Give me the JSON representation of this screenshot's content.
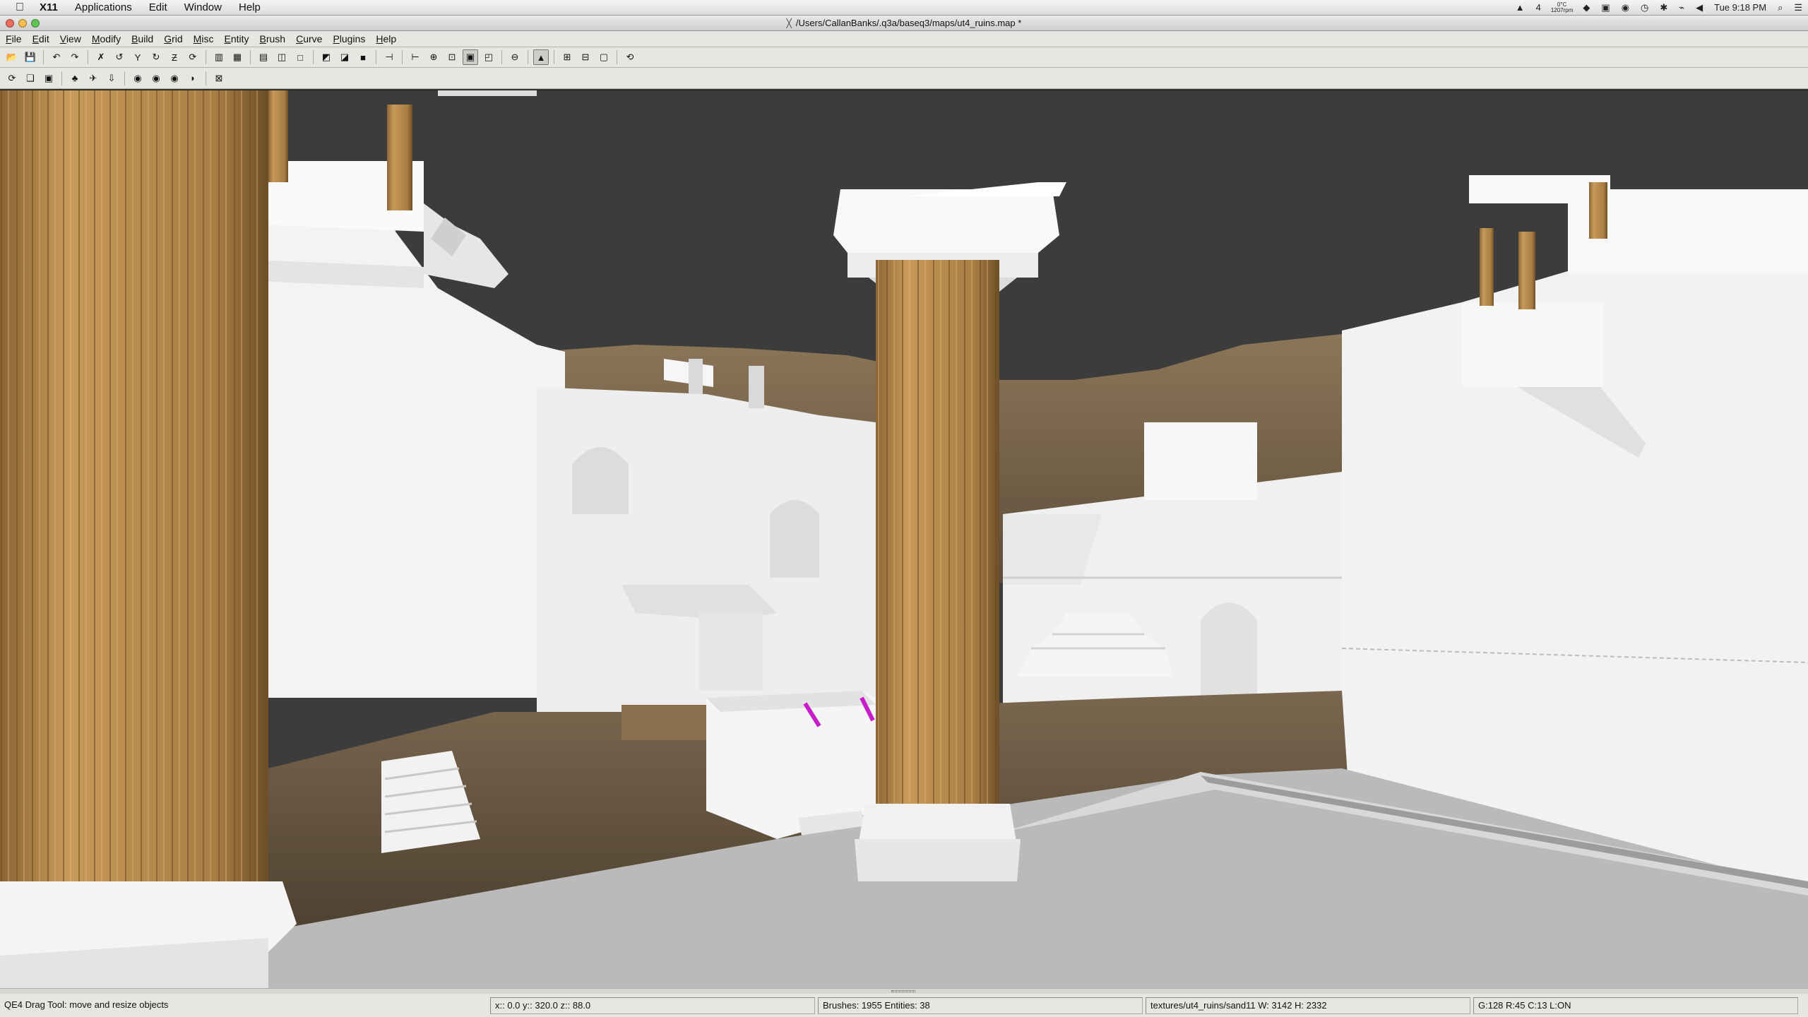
{
  "macbar": {
    "app_name": "X11",
    "menus": [
      "Applications",
      "Edit",
      "Window",
      "Help"
    ],
    "status": {
      "badge": "4",
      "temp": "0°C",
      "fan": "1207rpm",
      "clock": "Tue 9:18 PM"
    }
  },
  "window": {
    "title": "/Users/CallanBanks/.q3a/baseq3/maps/ut4_ruins.map *",
    "traffic_lights": [
      "#ed6a5e",
      "#f5bf4f",
      "#61c554"
    ]
  },
  "app_menu": [
    "File",
    "Edit",
    "View",
    "Modify",
    "Build",
    "Grid",
    "Misc",
    "Entity",
    "Brush",
    "Curve",
    "Plugins",
    "Help"
  ],
  "toolbar1": [
    {
      "icon": "open-folder-icon",
      "glyph": "📂"
    },
    {
      "icon": "save-icon",
      "glyph": "💾"
    },
    {
      "sep": true
    },
    {
      "icon": "undo-icon",
      "glyph": "↶"
    },
    {
      "icon": "redo-icon",
      "glyph": "↷"
    },
    {
      "sep": true
    },
    {
      "icon": "flip-x-icon",
      "glyph": "✗"
    },
    {
      "icon": "rotate-x-icon",
      "glyph": "↺"
    },
    {
      "icon": "flip-y-icon",
      "glyph": "Y"
    },
    {
      "icon": "rotate-y-icon",
      "glyph": "↻"
    },
    {
      "icon": "flip-z-icon",
      "glyph": "Ƶ"
    },
    {
      "icon": "rotate-z-icon",
      "glyph": "⟳"
    },
    {
      "sep": true
    },
    {
      "icon": "select-complete-tall-icon",
      "glyph": "▥"
    },
    {
      "icon": "select-touching-icon",
      "glyph": "▦"
    },
    {
      "sep": true
    },
    {
      "icon": "select-inside-icon",
      "glyph": "▤"
    },
    {
      "icon": "select-partial-icon",
      "glyph": "◫"
    },
    {
      "icon": "csg-subtract-icon",
      "glyph": "□"
    },
    {
      "sep": true
    },
    {
      "icon": "csg-merge-icon",
      "glyph": "◩"
    },
    {
      "icon": "hollow-icon",
      "glyph": "◪"
    },
    {
      "icon": "clipper-icon",
      "glyph": "■"
    },
    {
      "sep": true
    },
    {
      "icon": "change-view-icon",
      "glyph": "⊣"
    },
    {
      "sep": true
    },
    {
      "icon": "texture-view-icon",
      "glyph": "⊢"
    },
    {
      "icon": "cube-clip-icon",
      "glyph": "⊕"
    },
    {
      "icon": "camera-move-icon",
      "glyph": "⊡"
    },
    {
      "icon": "drag-vertex-icon",
      "glyph": "▣",
      "active": true
    },
    {
      "icon": "drag-edge-icon",
      "glyph": "◰"
    },
    {
      "sep": true
    },
    {
      "icon": "texture-lock-icon",
      "glyph": "⊖"
    },
    {
      "sep": true
    },
    {
      "icon": "show-entities-icon",
      "glyph": "▲",
      "active": true
    },
    {
      "sep": true
    },
    {
      "icon": "patch-inspector-icon",
      "glyph": "⊞"
    },
    {
      "icon": "surface-inspector-icon",
      "glyph": "⊟"
    },
    {
      "icon": "entity-window-icon",
      "glyph": "▢"
    },
    {
      "sep": true
    },
    {
      "icon": "refresh-shaders-icon",
      "glyph": "⟲"
    }
  ],
  "toolbar2": [
    {
      "icon": "plugin-bobtoolz-icon",
      "glyph": "⟳"
    },
    {
      "icon": "plugin-brush-icon",
      "glyph": "❑"
    },
    {
      "icon": "plugin-prt-icon",
      "glyph": "▣"
    },
    {
      "sep": true
    },
    {
      "icon": "plugin-tree-icon",
      "glyph": "♣"
    },
    {
      "icon": "plugin-camera-icon",
      "glyph": "✈"
    },
    {
      "icon": "plugin-arrow-icon",
      "glyph": "⇩"
    },
    {
      "sep": true
    },
    {
      "icon": "plugin-cat1-icon",
      "glyph": "◉"
    },
    {
      "icon": "plugin-cat2-icon",
      "glyph": "◉"
    },
    {
      "icon": "plugin-cat3-icon",
      "glyph": "◉"
    },
    {
      "icon": "plugin-cat4-icon",
      "glyph": "◗"
    },
    {
      "sep": true
    },
    {
      "icon": "plugin-no-icon",
      "glyph": "⊠"
    }
  ],
  "viewport": {
    "sky_color": "#3c3c3c",
    "stone_color": "#f1f1f1",
    "floor_color": "#b9b9b9",
    "column_color": "#b9894c",
    "dirt_color": "#6b5a44",
    "highlight_color": "#c71ec9"
  },
  "status": {
    "message": "QE4 Drag Tool: move and resize objects",
    "coords": "x::   0.0  y::  320.0  z::   88.0",
    "counts": "Brushes: 1955 Entities: 38",
    "texture": "textures/ut4_ruins/sand11 W: 3142 H: 2332",
    "grid": "G:128  R:45  C:13  L:ON"
  }
}
